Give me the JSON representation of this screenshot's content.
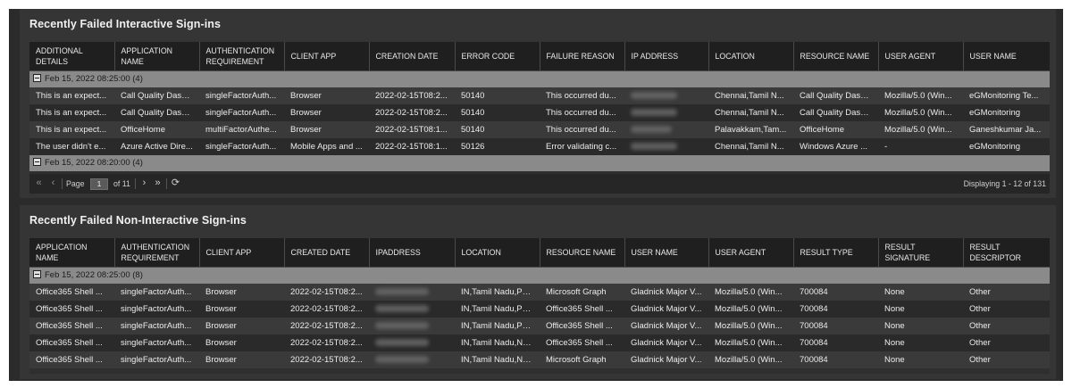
{
  "panel1": {
    "title": "Recently Failed Interactive Sign-ins",
    "columns": [
      "ADDITIONAL DETAILS",
      "APPLICATION NAME",
      "AUTHENTICATION REQUIREMENT",
      "CLIENT APP",
      "CREATION DATE",
      "ERROR CODE",
      "FAILURE REASON",
      "IP ADDRESS",
      "LOCATION",
      "RESOURCE NAME",
      "USER AGENT",
      "USER NAME"
    ],
    "groups": [
      {
        "label": "Feb 15, 2022 08:25:00 (4)",
        "rows": [
          [
            "This is an expect...",
            "Call Quality Dash...",
            "singleFactorAuth...",
            "Browser",
            "2022-02-15T08:2...",
            "50140",
            "This occurred du...",
            "",
            "Chennai,Tamil N...",
            "Call Quality Dash...",
            "Mozilla/5.0 (Win...",
            "eGMonitoring Te..."
          ],
          [
            "This is an expect...",
            "Call Quality Dash...",
            "singleFactorAuth...",
            "Browser",
            "2022-02-15T08:2...",
            "50140",
            "This occurred du...",
            "",
            "Chennai,Tamil N...",
            "Call Quality Dash...",
            "Mozilla/5.0 (Win...",
            "eGMonitoring"
          ],
          [
            "This is an expect...",
            "OfficeHome",
            "multiFactorAuthe...",
            "Browser",
            "2022-02-15T08:1...",
            "50140",
            "This occurred du...",
            "",
            "Palavakkam,Tam...",
            "OfficeHome",
            "Mozilla/5.0 (Win...",
            "Ganeshkumar Ja..."
          ],
          [
            "The user didn't e...",
            "Azure Active Dire...",
            "singleFactorAuth...",
            "Mobile Apps and ...",
            "2022-02-15T08:1...",
            "50126",
            "Error validating c...",
            "",
            "Chennai,Tamil N...",
            "Windows Azure ...",
            "-",
            "eGMonitoring"
          ]
        ]
      },
      {
        "label": "Feb 15, 2022 08:20:00 (4)",
        "rows": []
      }
    ],
    "pager": {
      "page_label": "Page",
      "page_value": "1",
      "of_label": "of 11",
      "display": "Displaying 1 - 12 of 131"
    }
  },
  "panel2": {
    "title": "Recently Failed Non-Interactive Sign-ins",
    "columns": [
      "APPLICATION NAME",
      "AUTHENTICATION REQUIREMENT",
      "CLIENT APP",
      "CREATED DATE",
      "IPADDRESS",
      "LOCATION",
      "RESOURCE NAME",
      "USER NAME",
      "USER AGENT",
      "RESULT TYPE",
      "RESULT SIGNATURE",
      "RESULT DESCRIPTOR"
    ],
    "groups": [
      {
        "label": "Feb 15, 2022 08:25:00 (8)",
        "rows": [
          [
            "Office365 Shell ...",
            "singleFactorAuth...",
            "Browser",
            "2022-02-15T08:2...",
            "",
            "IN,Tamil Nadu,Pu...",
            "Microsoft Graph",
            "Gladnick Major V...",
            "Mozilla/5.0 (Win...",
            "700084",
            "None",
            "Other"
          ],
          [
            "Office365 Shell ...",
            "singleFactorAuth...",
            "Browser",
            "2022-02-15T08:2...",
            "",
            "IN,Tamil Nadu,Pu...",
            "Office365 Shell ...",
            "Gladnick Major V...",
            "Mozilla/5.0 (Win...",
            "700084",
            "None",
            "Other"
          ],
          [
            "Office365 Shell ...",
            "singleFactorAuth...",
            "Browser",
            "2022-02-15T08:2...",
            "",
            "IN,Tamil Nadu,Pu...",
            "Office365 Shell ...",
            "Gladnick Major V...",
            "Mozilla/5.0 (Win...",
            "700084",
            "None",
            "Other"
          ],
          [
            "Office365 Shell ...",
            "singleFactorAuth...",
            "Browser",
            "2022-02-15T08:2...",
            "",
            "IN,Tamil Nadu,Ne...",
            "Office365 Shell ...",
            "Gladnick Major V...",
            "Mozilla/5.0 (Win...",
            "700084",
            "None",
            "Other"
          ],
          [
            "Office365 Shell ...",
            "singleFactorAuth...",
            "Browser",
            "2022-02-15T08:2...",
            "",
            "IN,Tamil Nadu,Ne...",
            "Microsoft Graph",
            "Gladnick Major V...",
            "Mozilla/5.0 (Win...",
            "700084",
            "None",
            "Other"
          ]
        ]
      }
    ]
  },
  "icons": {
    "first": "first-page-icon",
    "prev": "previous-page-icon",
    "next": "next-page-icon",
    "last": "last-page-icon",
    "refresh": "refresh-icon",
    "collapse": "collapse-group-icon"
  },
  "colors": {
    "background": "#2b2b2b",
    "panel": "#353535",
    "header": "#1f1f1f",
    "group_row": "#8a8a8a"
  }
}
